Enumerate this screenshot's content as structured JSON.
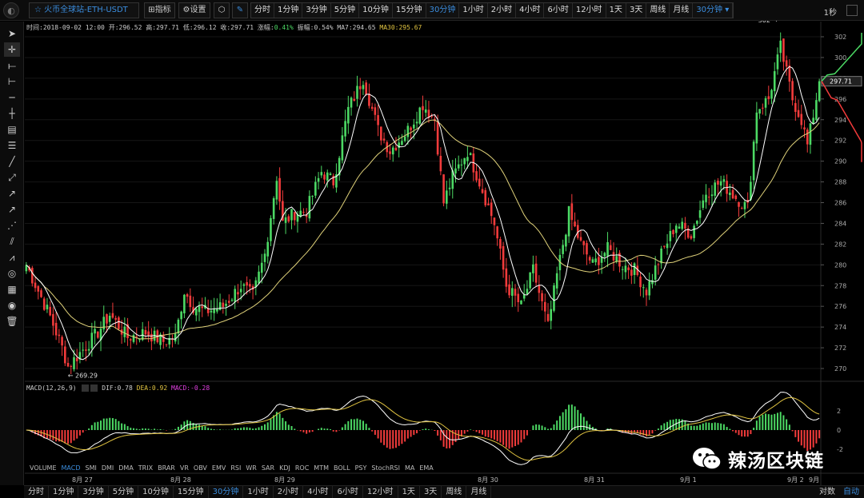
{
  "toolbar": {
    "symbol": "火币全球站-ETH-USDT",
    "indicators_label": "指标",
    "settings_label": "设置",
    "intervals": [
      "分时",
      "1分钟",
      "3分钟",
      "5分钟",
      "10分钟",
      "15分钟",
      "30分钟",
      "1小时",
      "2小时",
      "4小时",
      "6小时",
      "12小时",
      "1天",
      "3天",
      "周线",
      "月线"
    ],
    "active_interval": "30分钟",
    "interval_select": "30分钟",
    "refresh": "1秒"
  },
  "left_tools": [
    "cursor",
    "crosshair",
    "trend-line",
    "horizontal-ray",
    "horizontal-line",
    "vertical-line",
    "price-channel",
    "parallel-channel",
    "ray",
    "extended-line",
    "arrow",
    "fib-retracement",
    "fib-fan",
    "pitchfork",
    "gann-fan",
    "fib-spiral",
    "measure",
    "eye",
    "trash"
  ],
  "info": {
    "time": "时间:2018-09-02 12:00",
    "open": "开:296.52",
    "high": "高:297.71",
    "low": "低:296.12",
    "close": "收:297.71",
    "change_label": "涨幅:",
    "change": "0.41%",
    "amp": "振幅:0.54%",
    "ma7": "MA7:294.65",
    "ma30": "MA30:295.67"
  },
  "macd_header": {
    "name": "MACD(12,26,9)",
    "dif": "DIF:0.78",
    "dea": "DEA:0.92",
    "macd": "MACD:-0.28"
  },
  "indicator_tabs": [
    "VOLUME",
    "MACD",
    "SMI",
    "DMI",
    "DMA",
    "TRIX",
    "BRAR",
    "VR",
    "OBV",
    "EMV",
    "RSI",
    "WR",
    "SAR",
    "KDJ",
    "ROC",
    "MTM",
    "BOLL",
    "PSY",
    "StochRSI",
    "MA",
    "EMA"
  ],
  "active_indicator": "MACD",
  "bottom_intervals": [
    "分时",
    "1分钟",
    "3分钟",
    "5分钟",
    "10分钟",
    "15分钟",
    "30分钟",
    "1小时",
    "2小时",
    "4小时",
    "6小时",
    "12小时",
    "1天",
    "3天",
    "周线",
    "月线"
  ],
  "bottom_right": {
    "log": "对数",
    "auto": "自动"
  },
  "watermark": "辣汤区块链",
  "colors": {
    "up": "#4cd964",
    "down": "#f23b3b",
    "ma7": "#ffffff",
    "ma30": "#e0d27a",
    "dea": "#e0c341",
    "macd": "#e040e0",
    "accent": "#3b8dde"
  },
  "chart_data": {
    "type": "candlestick",
    "price_axis": {
      "ticks": [
        270,
        272,
        274,
        276,
        278,
        280,
        282,
        284,
        286,
        288,
        290,
        292,
        294,
        296,
        298,
        300,
        302
      ],
      "range": [
        269,
        303
      ]
    },
    "macd_axis": {
      "ticks": [
        -2,
        0,
        2
      ],
      "range": [
        -3.5,
        3
      ]
    },
    "date_ticks": [
      "8月 27",
      "8月 28",
      "8月 29",
      "8月 30",
      "8月 31",
      "9月 1",
      "9月 2",
      "9月 3"
    ],
    "last_price": "297.71",
    "high_annotation": "302",
    "low_annotation": "269.29",
    "series": [
      {
        "name": "MA7",
        "values": "derived from candles"
      },
      {
        "name": "MA30",
        "values": "derived from candles"
      }
    ],
    "anchors": [
      {
        "t": 0,
        "p": 280
      },
      {
        "t": 4,
        "p": 277.5
      },
      {
        "t": 8,
        "p": 275
      },
      {
        "t": 12,
        "p": 272
      },
      {
        "t": 14,
        "p": 270.2
      },
      {
        "t": 18,
        "p": 271.5
      },
      {
        "t": 24,
        "p": 273.5
      },
      {
        "t": 28,
        "p": 275.2
      },
      {
        "t": 34,
        "p": 273
      },
      {
        "t": 40,
        "p": 273.5
      },
      {
        "t": 46,
        "p": 272.6
      },
      {
        "t": 50,
        "p": 273
      },
      {
        "t": 53,
        "p": 277.5
      },
      {
        "t": 56,
        "p": 276
      },
      {
        "t": 60,
        "p": 275.5
      },
      {
        "t": 66,
        "p": 276
      },
      {
        "t": 72,
        "p": 278
      },
      {
        "t": 76,
        "p": 277
      },
      {
        "t": 80,
        "p": 281
      },
      {
        "t": 84,
        "p": 288.5
      },
      {
        "t": 86,
        "p": 284
      },
      {
        "t": 90,
        "p": 285
      },
      {
        "t": 94,
        "p": 285.2
      },
      {
        "t": 99,
        "p": 289
      },
      {
        "t": 103,
        "p": 288
      },
      {
        "t": 108,
        "p": 295
      },
      {
        "t": 113,
        "p": 298
      },
      {
        "t": 118,
        "p": 293
      },
      {
        "t": 122,
        "p": 291
      },
      {
        "t": 128,
        "p": 293
      },
      {
        "t": 133,
        "p": 295.5
      },
      {
        "t": 137,
        "p": 294
      },
      {
        "t": 140,
        "p": 286
      },
      {
        "t": 143,
        "p": 288.5
      },
      {
        "t": 148,
        "p": 291
      },
      {
        "t": 152,
        "p": 288
      },
      {
        "t": 157,
        "p": 284
      },
      {
        "t": 161,
        "p": 278
      },
      {
        "t": 166,
        "p": 276
      },
      {
        "t": 170,
        "p": 279.5
      },
      {
        "t": 175,
        "p": 274
      },
      {
        "t": 178,
        "p": 279
      },
      {
        "t": 182,
        "p": 285
      },
      {
        "t": 186,
        "p": 282
      },
      {
        "t": 190,
        "p": 280
      },
      {
        "t": 195,
        "p": 281.5
      },
      {
        "t": 200,
        "p": 280
      },
      {
        "t": 204,
        "p": 279.5
      },
      {
        "t": 208,
        "p": 277.5
      },
      {
        "t": 213,
        "p": 281
      },
      {
        "t": 218,
        "p": 284
      },
      {
        "t": 223,
        "p": 283
      },
      {
        "t": 228,
        "p": 287
      },
      {
        "t": 233,
        "p": 288
      },
      {
        "t": 238,
        "p": 286.5
      },
      {
        "t": 242,
        "p": 285.5
      },
      {
        "t": 245,
        "p": 295
      },
      {
        "t": 249,
        "p": 296
      },
      {
        "t": 253,
        "p": 301
      },
      {
        "t": 257,
        "p": 296
      },
      {
        "t": 260,
        "p": 294
      },
      {
        "t": 262,
        "p": 291.5
      },
      {
        "t": 264,
        "p": 294.5
      },
      {
        "t": 266,
        "p": 297.7
      }
    ]
  }
}
